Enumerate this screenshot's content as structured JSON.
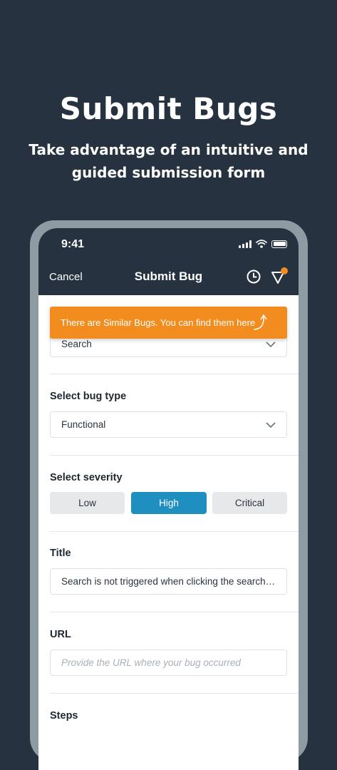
{
  "hero": {
    "title": "Submit Bugs",
    "subtitle_line1": "Take advantage of an intuitive and",
    "subtitle_line2": "guided submission form"
  },
  "status_bar": {
    "time": "9:41"
  },
  "nav": {
    "cancel_label": "Cancel",
    "title": "Submit Bug"
  },
  "toast": {
    "message": "There are Similar Bugs. You can find them here"
  },
  "fields": {
    "search": {
      "value": "Search"
    },
    "bug_type": {
      "label": "Select bug type",
      "value": "Functional"
    },
    "severity": {
      "label": "Select severity",
      "options": [
        "Low",
        "High",
        "Critical"
      ],
      "selected": "High"
    },
    "title": {
      "label": "Title",
      "value": "Search is not triggered when clicking the search button"
    },
    "url": {
      "label": "URL",
      "placeholder": "Provide the URL where your bug occurred"
    },
    "steps": {
      "label": "Steps"
    }
  },
  "colors": {
    "background": "#263240",
    "accent": "#1f8fbf",
    "toast": "#f28c1e",
    "frame": "#8e9ba3"
  }
}
